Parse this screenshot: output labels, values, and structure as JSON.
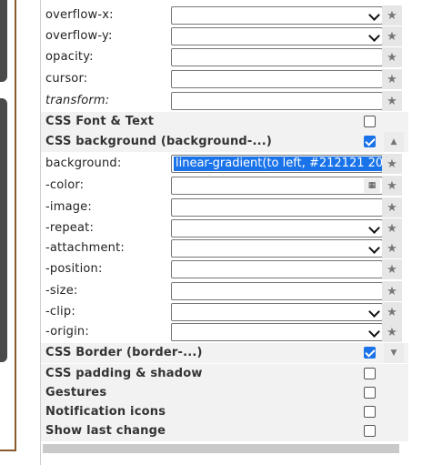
{
  "rows": [
    {
      "label": "overflow-x:"
    },
    {
      "label": "overflow-y:"
    },
    {
      "label": "opacity:"
    },
    {
      "label": "cursor:"
    },
    {
      "label": "transform:"
    }
  ],
  "sections": {
    "font_text": "CSS Font & Text",
    "background": "CSS background (background-...)",
    "border": "CSS Border (border-...)",
    "padding": "CSS padding & shadow",
    "gestures": "Gestures",
    "notifications": "Notification icons",
    "last_change": "Show last change"
  },
  "background": {
    "label": "background:",
    "value": "linear-gradient(to left, #212121 20",
    "color_label": "-color:",
    "image_label": "-image:",
    "repeat_label": "-repeat:",
    "attachment_label": "-attachment:",
    "position_label": "-position:",
    "size_label": "-size:",
    "clip_label": "-clip:",
    "origin_label": "-origin:"
  },
  "icons": {
    "star": "★",
    "up": "▲",
    "down": "▼",
    "color_picker": "▦"
  }
}
